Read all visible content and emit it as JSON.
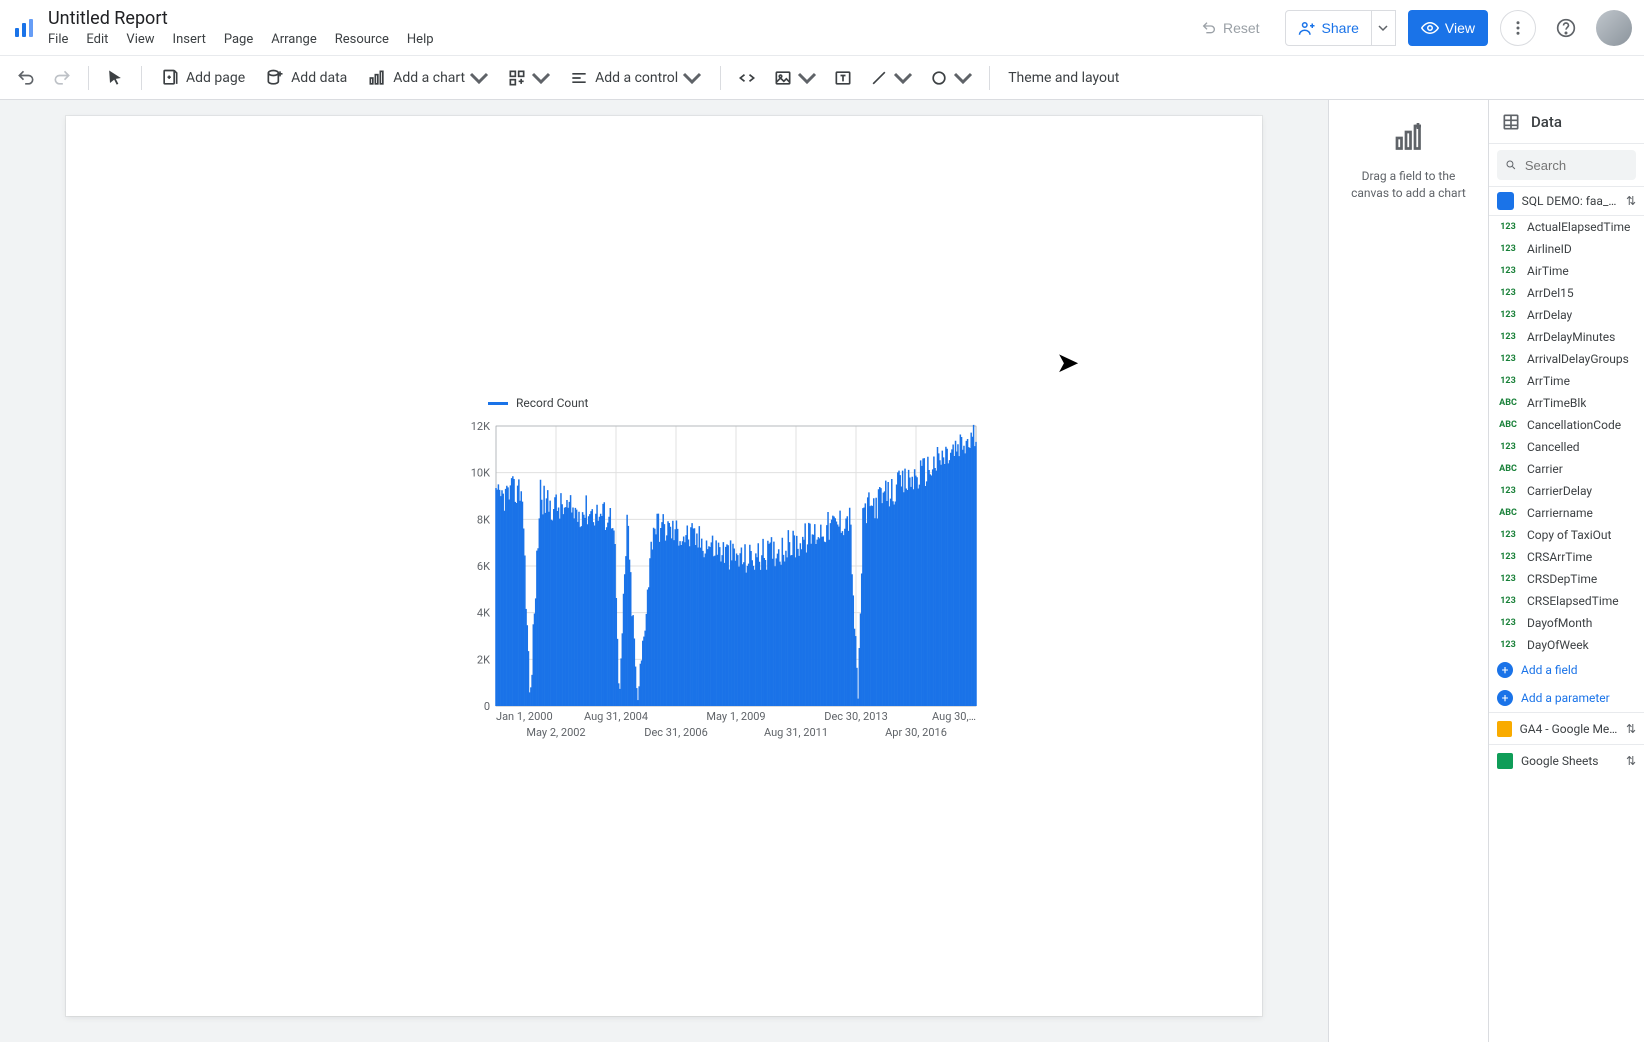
{
  "doc": {
    "title": "Untitled Report"
  },
  "menus": [
    "File",
    "Edit",
    "View",
    "Insert",
    "Page",
    "Arrange",
    "Resource",
    "Help"
  ],
  "top_actions": {
    "reset": "Reset",
    "share": "Share",
    "view": "View"
  },
  "toolbar": {
    "add_page": "Add page",
    "add_data": "Add data",
    "add_chart": "Add a chart",
    "add_control": "Add a control",
    "theme": "Theme and layout"
  },
  "drag_panel": {
    "hint": "Drag a field to the canvas to add a chart"
  },
  "data_panel": {
    "title": "Data",
    "search_placeholder": "Search",
    "add_field": "Add a field",
    "add_parameter": "Add a parameter",
    "datasources": [
      {
        "id": "ds1",
        "name": "SQL DEMO: faa_fli…",
        "kind": "bq",
        "expanded": true,
        "fields": [
          {
            "name": "ActualElapsedTime",
            "type": "num"
          },
          {
            "name": "AirlineID",
            "type": "num"
          },
          {
            "name": "AirTime",
            "type": "num"
          },
          {
            "name": "ArrDel15",
            "type": "num"
          },
          {
            "name": "ArrDelay",
            "type": "num"
          },
          {
            "name": "ArrDelayMinutes",
            "type": "num"
          },
          {
            "name": "ArrivalDelayGroups",
            "type": "num"
          },
          {
            "name": "ArrTime",
            "type": "num"
          },
          {
            "name": "ArrTimeBlk",
            "type": "abc"
          },
          {
            "name": "CancellationCode",
            "type": "abc"
          },
          {
            "name": "Cancelled",
            "type": "num"
          },
          {
            "name": "Carrier",
            "type": "abc"
          },
          {
            "name": "CarrierDelay",
            "type": "num"
          },
          {
            "name": "Carriername",
            "type": "abc"
          },
          {
            "name": "Copy of TaxiOut",
            "type": "num"
          },
          {
            "name": "CRSArrTime",
            "type": "num"
          },
          {
            "name": "CRSDepTime",
            "type": "num"
          },
          {
            "name": "CRSElapsedTime",
            "type": "num"
          },
          {
            "name": "DayofMonth",
            "type": "num"
          },
          {
            "name": "DayOfWeek",
            "type": "num"
          }
        ]
      },
      {
        "id": "ds2",
        "name": "GA4 - Google Merc…",
        "kind": "ga",
        "expanded": false
      },
      {
        "id": "ds3",
        "name": "Google Sheets",
        "kind": "gs",
        "expanded": false
      }
    ]
  },
  "chart_data": {
    "type": "line",
    "title": "",
    "legend": "Record Count",
    "xlabel": "",
    "ylabel": "",
    "ylim": [
      0,
      12000
    ],
    "y_ticks": [
      "0",
      "2K",
      "4K",
      "6K",
      "8K",
      "10K",
      "12K"
    ],
    "x_ticks_top": [
      "Jan 1, 2000",
      "Aug 31, 2004",
      "May 1, 2009",
      "Dec 30, 2013",
      "Aug 30,…"
    ],
    "x_ticks_bottom": [
      "May 2, 2002",
      "Dec 31, 2006",
      "Aug 31, 2011",
      "Apr 30, 2016"
    ],
    "x": [
      2000.0,
      2000.5,
      2001.0,
      2001.3,
      2001.7,
      2001.8,
      2002.0,
      2002.5,
      2003.0,
      2003.5,
      2004.0,
      2004.5,
      2004.7,
      2005.0,
      2005.4,
      2006.0,
      2006.5,
      2007.0,
      2007.5,
      2008.0,
      2008.5,
      2009.0,
      2009.5,
      2010.0,
      2010.5,
      2011.0,
      2011.5,
      2012.0,
      2012.5,
      2013.0,
      2013.5,
      2013.8,
      2014.0,
      2014.5,
      2015.0,
      2015.5,
      2016.0,
      2016.5,
      2017.0,
      2017.5,
      2018.0,
      2018.3
    ],
    "values": [
      8800,
      9100,
      9300,
      100,
      9400,
      8800,
      8600,
      8500,
      8300,
      8400,
      8200,
      8100,
      100,
      8000,
      100,
      7800,
      7600,
      7400,
      7200,
      7000,
      6700,
      6400,
      6300,
      6400,
      6600,
      6800,
      7000,
      7300,
      7600,
      7800,
      8100,
      100,
      8300,
      8700,
      9100,
      9500,
      9800,
      10200,
      10600,
      10900,
      11300,
      11600
    ],
    "color": "#1a73e8"
  }
}
